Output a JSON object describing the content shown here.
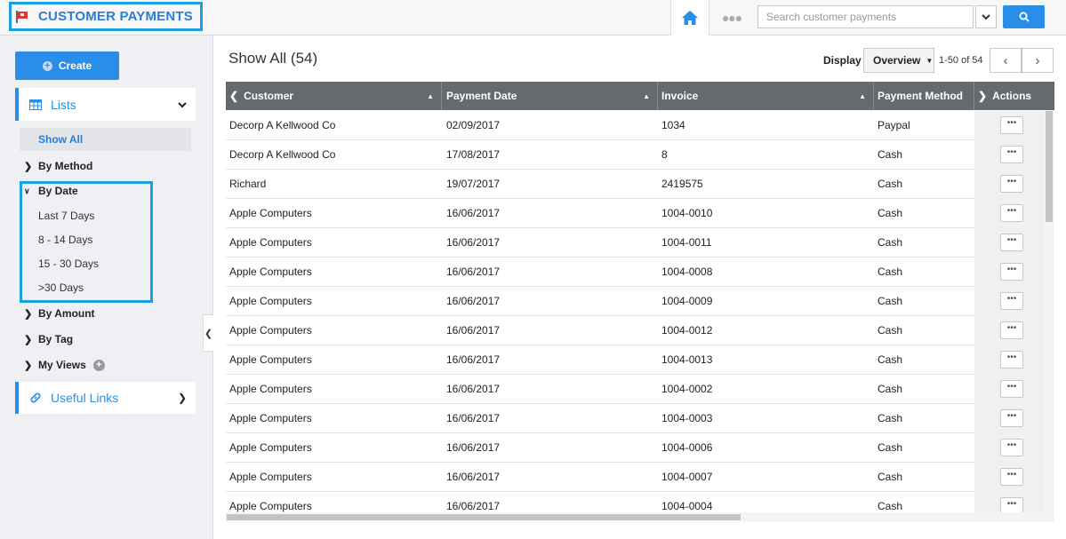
{
  "app": {
    "title": "CUSTOMER PAYMENTS"
  },
  "topbar": {
    "home_icon": "home-icon",
    "more_icon": "ellipsis-icon",
    "search_placeholder": "Search customer payments",
    "accent_color": "#2a8ee8"
  },
  "sidebar": {
    "create_label": "Create",
    "lists_label": "Lists",
    "show_all_label": "Show All",
    "items": [
      {
        "label": "By Method",
        "expanded": false
      },
      {
        "label": "By Date",
        "expanded": true,
        "children": [
          "Last 7 Days",
          "8 - 14 Days",
          "15 - 30 Days",
          ">30 Days"
        ]
      },
      {
        "label": "By Amount",
        "expanded": false
      },
      {
        "label": "By Tag",
        "expanded": false
      },
      {
        "label": "My Views",
        "expanded": false
      }
    ],
    "useful_links_label": "Useful Links"
  },
  "main": {
    "title": "Show All (54)",
    "display_label": "Display",
    "display_value": "Overview",
    "page_range": "1-50 of 54"
  },
  "table": {
    "columns": [
      "Customer",
      "Payment Date",
      "Invoice",
      "Payment Method",
      "Actions"
    ],
    "actions_glyph": "•••",
    "rows": [
      [
        "Decorp A Kellwood Co",
        "02/09/2017",
        "1034",
        "Paypal"
      ],
      [
        "Decorp A Kellwood Co",
        "17/08/2017",
        "8",
        "Cash"
      ],
      [
        "Richard",
        "19/07/2017",
        "2419575",
        "Cash"
      ],
      [
        "Apple Computers",
        "16/06/2017",
        "1004-0010",
        "Cash"
      ],
      [
        "Apple Computers",
        "16/06/2017",
        "1004-0011",
        "Cash"
      ],
      [
        "Apple Computers",
        "16/06/2017",
        "1004-0008",
        "Cash"
      ],
      [
        "Apple Computers",
        "16/06/2017",
        "1004-0009",
        "Cash"
      ],
      [
        "Apple Computers",
        "16/06/2017",
        "1004-0012",
        "Cash"
      ],
      [
        "Apple Computers",
        "16/06/2017",
        "1004-0013",
        "Cash"
      ],
      [
        "Apple Computers",
        "16/06/2017",
        "1004-0002",
        "Cash"
      ],
      [
        "Apple Computers",
        "16/06/2017",
        "1004-0003",
        "Cash"
      ],
      [
        "Apple Computers",
        "16/06/2017",
        "1004-0006",
        "Cash"
      ],
      [
        "Apple Computers",
        "16/06/2017",
        "1004-0007",
        "Cash"
      ],
      [
        "Apple Computers",
        "16/06/2017",
        "1004-0004",
        "Cash"
      ]
    ]
  }
}
